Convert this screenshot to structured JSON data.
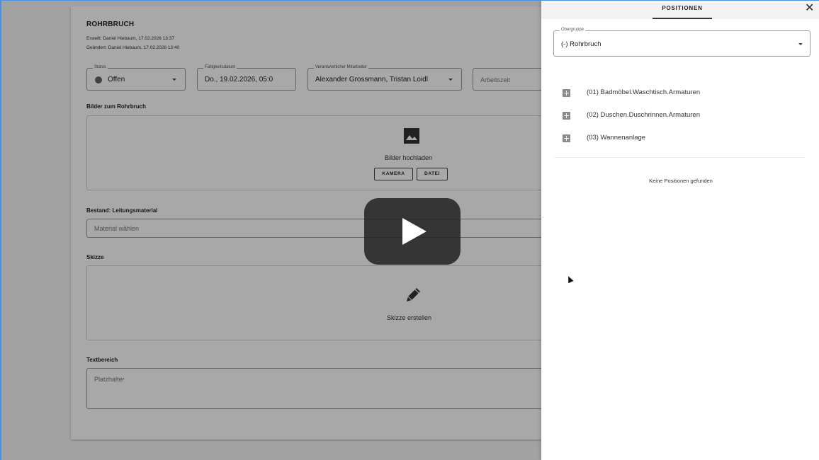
{
  "form": {
    "title": "ROHRBRUCH",
    "created": "Erstellt: Daniel Hiebaum, 17.02.2026 13:37",
    "changed": "Geändert: Daniel Hiebaum, 17.02.2026 13:40",
    "status": {
      "label": "Status",
      "value": "Offen"
    },
    "due_date": {
      "label": "Fälligkeitsdatum",
      "value": "Do., 19.02.2026, 05:0"
    },
    "employee": {
      "label": "Verantwortlicher Mitarbeiter",
      "value": "Alexander Grossmann, Tristan Loidl"
    },
    "worktime": {
      "placeholder": "Arbeitszeit"
    },
    "images_section": "Bilder zum Rohrbruch",
    "images_upload": "Bilder hochladen",
    "camera_button": "KAMERA",
    "file_button": "DATEI",
    "material_section": "Bestand: Leitungsmaterial",
    "material_placeholder": "Material wählen",
    "sketch_section": "Skizze",
    "sketch_create": "Skizze erstellen",
    "text_section": "Textbereich",
    "text_placeholder": "Platzhalter"
  },
  "panel": {
    "tab": "POSITIONEN",
    "close": "✕",
    "group_label": "Obergruppe",
    "group_value": "(-) Rohrbruch",
    "items": [
      {
        "label": "(01) Badmöbel.Waschtisch.Armaturen"
      },
      {
        "label": "(02) Duschen.Duschrinnen.Armaturen"
      },
      {
        "label": "(03) Wannenanlage"
      }
    ],
    "empty_text": "Keine Positionen gefunden"
  },
  "colors": {
    "accent_border": "#4a90e2",
    "overlay": "rgba(0,0,0,0.34)",
    "play_button": "#212121"
  }
}
